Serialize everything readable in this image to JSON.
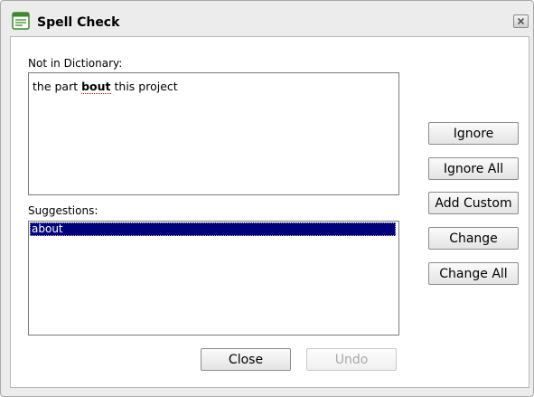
{
  "window": {
    "title": "Spell Check"
  },
  "not_in_dictionary": {
    "label": "Not in Dictionary:",
    "before": "the part ",
    "word": "bout",
    "after": " this project"
  },
  "suggestions": {
    "label": "Suggestions:",
    "items": [
      "about"
    ],
    "selected": "about"
  },
  "buttons": {
    "ignore": "Ignore",
    "ignore_all": "Ignore All",
    "add_custom": "Add Custom",
    "change": "Change",
    "change_all": "Change All",
    "close": "Close",
    "undo": "Undo"
  },
  "icons": {
    "app": "spellcheck-document-icon",
    "close": "close-icon"
  },
  "colors": {
    "selection": "#00007a",
    "icon_green": "#3c8a2e"
  }
}
